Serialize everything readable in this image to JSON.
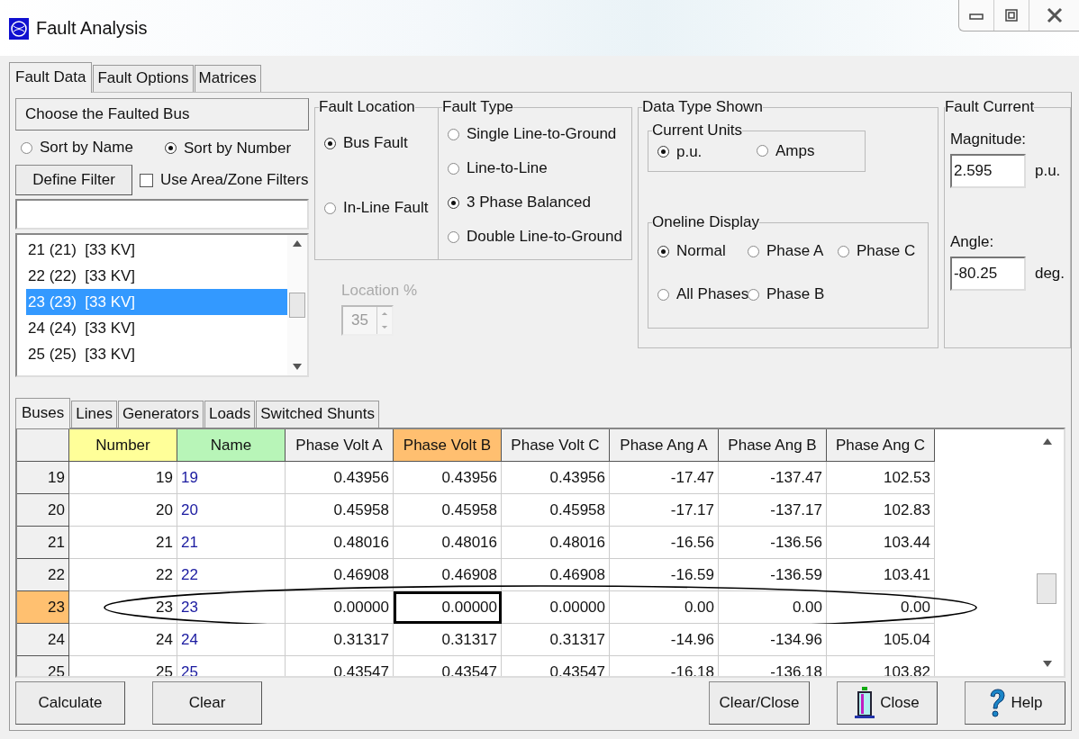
{
  "window": {
    "title": "Fault Analysis"
  },
  "tabs": [
    {
      "label": "Fault Data",
      "selected": true
    },
    {
      "label": "Fault Options",
      "selected": false
    },
    {
      "label": "Matrices",
      "selected": false
    }
  ],
  "bus_chooser": {
    "title": "Choose the Faulted Bus",
    "sort_options": [
      {
        "label": "Sort by Name",
        "selected": false
      },
      {
        "label": "Sort by Number",
        "selected": true
      }
    ],
    "filter_button": "Define Filter",
    "area_zone_filter": {
      "label": "Use Area/Zone Filters",
      "checked": false
    },
    "buses": [
      {
        "label": "21 (21)  [33 KV]",
        "selected": false
      },
      {
        "label": "22 (22)  [33 KV]",
        "selected": false
      },
      {
        "label": "23 (23)  [33 KV]",
        "selected": true
      },
      {
        "label": "24 (24)  [33 KV]",
        "selected": false
      },
      {
        "label": "25 (25)  [33 KV]",
        "selected": false
      }
    ]
  },
  "fault_location": {
    "title": "Fault Location",
    "options": [
      {
        "label": "Bus Fault",
        "selected": true
      },
      {
        "label": "In-Line Fault",
        "selected": false
      }
    ],
    "location_label": "Location %",
    "location_value": "35",
    "disabled": true
  },
  "fault_type": {
    "title": "Fault Type",
    "options": [
      {
        "label": "Single Line-to-Ground",
        "selected": false
      },
      {
        "label": "Line-to-Line",
        "selected": false
      },
      {
        "label": "3 Phase Balanced",
        "selected": true
      },
      {
        "label": "Double Line-to-Ground",
        "selected": false
      }
    ]
  },
  "data_type": {
    "title": "Data Type Shown",
    "current_units": {
      "title": "Current Units",
      "options": [
        {
          "label": "p.u.",
          "selected": true
        },
        {
          "label": "Amps",
          "selected": false
        }
      ]
    },
    "oneline_display": {
      "title": "Oneline Display",
      "options": [
        {
          "label": "Normal",
          "selected": true
        },
        {
          "label": "Phase A",
          "selected": false
        },
        {
          "label": "Phase C",
          "selected": false
        },
        {
          "label": "All Phases",
          "selected": false
        },
        {
          "label": "Phase B",
          "selected": false
        }
      ]
    }
  },
  "fault_current": {
    "title": "Fault Current",
    "magnitude_label": "Magnitude:",
    "magnitude": "2.595",
    "magnitude_unit": "p.u.",
    "angle_label": "Angle:",
    "angle": "-80.25",
    "angle_unit": "deg."
  },
  "result_tabs": [
    {
      "label": "Buses",
      "selected": true
    },
    {
      "label": "Lines",
      "selected": false
    },
    {
      "label": "Generators",
      "selected": false
    },
    {
      "label": "Loads",
      "selected": false
    },
    {
      "label": "Switched Shunts",
      "selected": false
    }
  ],
  "table": {
    "columns": [
      {
        "label": "Number",
        "color": "#ffff99",
        "selected": false
      },
      {
        "label": "Name",
        "color": "#b8f5b8",
        "selected": false
      },
      {
        "label": "Phase Volt A",
        "selected": false
      },
      {
        "label": "Phase Volt B",
        "selected": true
      },
      {
        "label": "Phase Volt C",
        "selected": false
      },
      {
        "label": "Phase Ang A",
        "selected": false
      },
      {
        "label": "Phase Ang B",
        "selected": false
      },
      {
        "label": "Phase Ang C",
        "selected": false
      }
    ],
    "rows": [
      {
        "header": "19",
        "selected": false,
        "circled": false,
        "cells": [
          "19",
          "19",
          "0.43956",
          "0.43956",
          "0.43956",
          "-17.47",
          "-137.47",
          "102.53"
        ]
      },
      {
        "header": "20",
        "selected": false,
        "circled": false,
        "cells": [
          "20",
          "20",
          "0.45958",
          "0.45958",
          "0.45958",
          "-17.17",
          "-137.17",
          "102.83"
        ]
      },
      {
        "header": "21",
        "selected": false,
        "circled": false,
        "cells": [
          "21",
          "21",
          "0.48016",
          "0.48016",
          "0.48016",
          "-16.56",
          "-136.56",
          "103.44"
        ]
      },
      {
        "header": "22",
        "selected": false,
        "circled": false,
        "cells": [
          "22",
          "22",
          "0.46908",
          "0.46908",
          "0.46908",
          "-16.59",
          "-136.59",
          "103.41"
        ]
      },
      {
        "header": "23",
        "selected": true,
        "circled": true,
        "cells": [
          "23",
          "23",
          "0.00000",
          "0.00000",
          "0.00000",
          "0.00",
          "0.00",
          "0.00"
        ]
      },
      {
        "header": "24",
        "selected": false,
        "circled": false,
        "cells": [
          "24",
          "24",
          "0.31317",
          "0.31317",
          "0.31317",
          "-14.96",
          "-134.96",
          "105.04"
        ]
      },
      {
        "header": "25",
        "selected": false,
        "circled": false,
        "cells": [
          "25",
          "25",
          "0.43547",
          "0.43547",
          "0.43547",
          "-16.18",
          "-136.18",
          "103.82"
        ]
      }
    ]
  },
  "left_buttons": [
    {
      "label": "Calculate"
    },
    {
      "label": "Clear"
    }
  ],
  "right_buttons": [
    {
      "label": "Clear/Close",
      "kind": "plain"
    },
    {
      "label": "Close",
      "kind": "close"
    },
    {
      "label": "Help",
      "kind": "help"
    }
  ]
}
